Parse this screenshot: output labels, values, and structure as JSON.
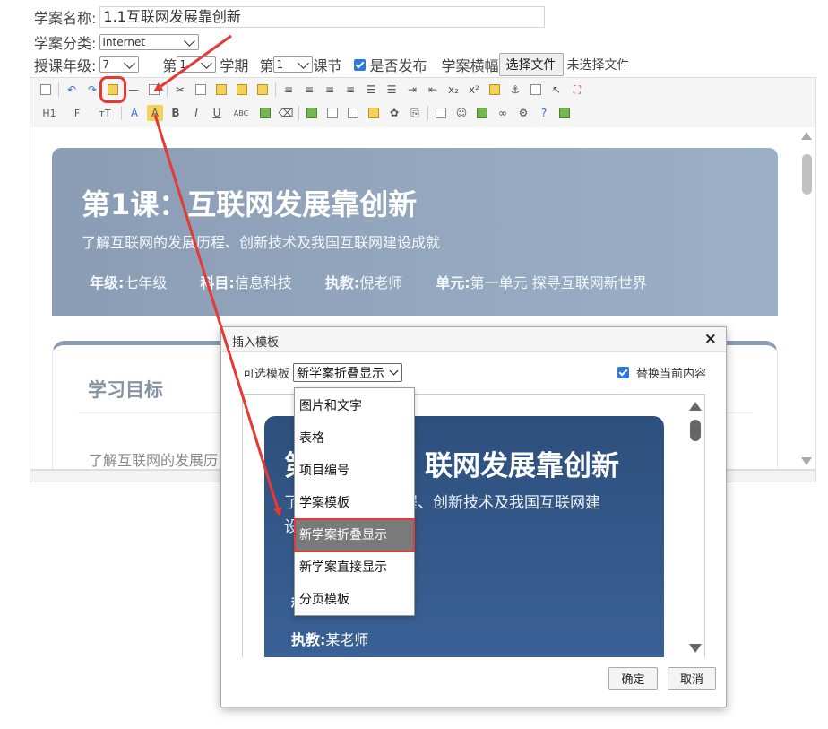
{
  "form": {
    "name_label": "学案名称:",
    "name_value": "1.1互联网发展靠创新",
    "category_label": "学案分类:",
    "category_value": "Internet",
    "grade_label": "授课年级:",
    "grade_value": "7",
    "term_prefix": "第",
    "term_value": "1",
    "term_suffix": "学期",
    "lesson_prefix": "第",
    "lesson_value": "1",
    "lesson_suffix": "课节",
    "publish_label": "是否发布",
    "publish_checked": true,
    "banner_label": "学案横幅",
    "choose_file_label": "选择文件",
    "no_file_label": "未选择文件"
  },
  "toolbar": {
    "row1_icons": [
      "source-icon",
      "undo-icon",
      "redo-icon",
      "insert-template-icon",
      "horizontal-rule-icon",
      "clear-format-icon",
      "cut-icon",
      "copy-icon",
      "paste-icon",
      "paste-text-icon",
      "paste-word-icon",
      "align-left-icon",
      "align-center-icon",
      "align-right-icon",
      "align-justify-icon",
      "ordered-list-icon",
      "unordered-list-icon",
      "indent-icon",
      "outdent-icon",
      "subscript-icon",
      "superscript-icon",
      "format-brush-icon",
      "anchor-icon",
      "code-icon",
      "select-all-icon",
      "fullscreen-icon"
    ],
    "row2_labels": {
      "heading": "H1",
      "font": "F",
      "size": "тT",
      "font_color": "A",
      "bg_color": "A",
      "bold": "B",
      "italic": "I",
      "underline": "U",
      "strike": "ABC"
    }
  },
  "editor": {
    "hero_title": "第1课：互联网发展靠创新",
    "hero_subtitle": "了解互联网的发展历程、创新技术及我国互联网建设成就",
    "meta": [
      {
        "key": "年级:",
        "value": "七年级"
      },
      {
        "key": "科目:",
        "value": "信息科技"
      },
      {
        "key": "执教:",
        "value": "倪老师"
      },
      {
        "key": "单元:",
        "value": "第一单元 探寻互联网新世界"
      }
    ],
    "goal_title": "学习目标",
    "goal_text": "了解互联网的发展历"
  },
  "dialog": {
    "title": "插入模板",
    "close": "×",
    "template_label": "可选模板",
    "template_selected": "新学案折叠显示",
    "replace_label": "替换当前内容",
    "replace_checked": true,
    "options": [
      "图片和文字",
      "表格",
      "项目编号",
      "学案模板",
      "新学案折叠显示",
      "新学案直接显示",
      "分页模板"
    ],
    "selected_index": 4,
    "ok_label": "确定",
    "cancel_label": "取消"
  },
  "preview": {
    "title_part": "联网发展靠创新",
    "title_lead": "第",
    "subtitle_lead": "了",
    "subtitle_part": "历程、创新技术及我国互联网建",
    "subtitle_line2": "设",
    "teacher_key": "执教:",
    "teacher_value": "某老师",
    "other_key": "科"
  },
  "colors": {
    "accent": "#2a7ae2",
    "hero_bg": "#8b9db5",
    "preview_bg": "#2d4f7c",
    "annotation_red": "#e53935"
  }
}
